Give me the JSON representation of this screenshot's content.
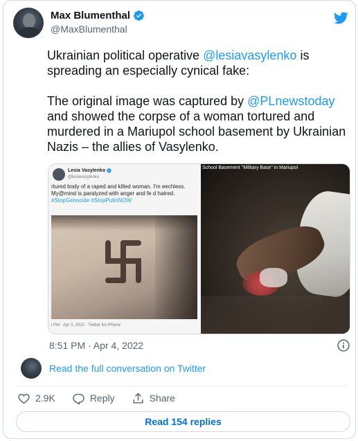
{
  "author": {
    "name": "Max Blumenthal",
    "handle": "@MaxBlumenthal"
  },
  "tweet": {
    "p1_pre": "Ukrainian political operative ",
    "p1_mention": "@lesiavasylenko",
    "p1_post": " is spreading an especially cynical fake:",
    "p2_pre": "The original image was captured by ",
    "p2_mention": "@PLnewstoday",
    "p2_post": " and showed the corpse of a woman tortured and murdered in a Mariupol school basement by Ukrainian Nazis – the allies of Vasylenko."
  },
  "media": {
    "left": {
      "name": "Lesia Vasylenko",
      "handle": "@lesiavasylenko",
      "text": "rtured body of a raped and killed woman. I'm eechless. My@mind is paralyzed with anger and fe d hatred. ",
      "tags": "#StopGenocide #StopPutinNOW",
      "footer": "l PM · Apr 3, 2022 · Twitter for iPhone"
    },
    "right": {
      "caption": "School Basement \"Military Base\" in Mariupol"
    }
  },
  "timestamp": "8:51 PM · Apr 4, 2022",
  "conversation": {
    "link": "Read the full conversation on Twitter"
  },
  "actions": {
    "likes": "2.9K",
    "reply": "Reply",
    "share": "Share"
  },
  "replies_button": "Read 154 replies",
  "colors": {
    "accent": "#1d9bf0",
    "text": "#0f1419",
    "secondary": "#536471",
    "border": "#cfd9de"
  }
}
